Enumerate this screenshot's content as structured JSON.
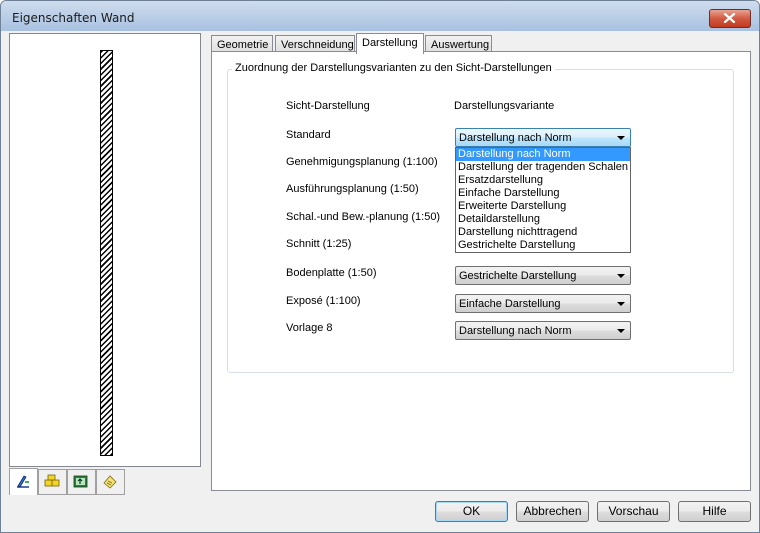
{
  "window": {
    "title": "Eigenschaften Wand"
  },
  "tabs": [
    {
      "label": "Geometrie"
    },
    {
      "label": "Verschneidung"
    },
    {
      "label": "Darstellung"
    },
    {
      "label": "Auswertung"
    }
  ],
  "active_tab": "Darstellung",
  "group": {
    "title": "Zuordnung der Darstellungsvarianten zu den Sicht-Darstellungen",
    "header_left": "Sicht-Darstellung",
    "header_right": "Darstellungsvariante"
  },
  "rows": [
    {
      "label": "Standard",
      "value": "Darstellung nach Norm"
    },
    {
      "label": "Genehmigungsplanung (1:100)",
      "value": ""
    },
    {
      "label": "Ausführungsplanung (1:50)",
      "value": ""
    },
    {
      "label": "Schal.-und Bew.-planung (1:50)",
      "value": ""
    },
    {
      "label": "Schnitt (1:25)",
      "value": ""
    },
    {
      "label": "Bodenplatte (1:50)",
      "value": "Gestrichelte Darstellung"
    },
    {
      "label": "Exposé (1:100)",
      "value": "Einfache Darstellung"
    },
    {
      "label": "Vorlage 8",
      "value": "Darstellung nach Norm"
    }
  ],
  "dropdown": {
    "options": [
      "Darstellung nach Norm",
      "Darstellung der tragenden Schalen",
      "Ersatzdarstellung",
      "Einfache Darstellung",
      "Erweiterte Darstellung",
      "Detaildarstellung",
      "Darstellung nichttragend",
      "Gestrichelte Darstellung"
    ],
    "selected": "Darstellung nach Norm"
  },
  "buttons": {
    "ok": "OK",
    "cancel": "Abbrechen",
    "preview": "Vorschau",
    "help": "Hilfe"
  },
  "icon_tabs": [
    "drawing-properties-icon",
    "layers-icon",
    "attributes-icon",
    "notes-icon"
  ],
  "colors": {
    "selection": "#3399ff",
    "titlebar": "#b9cde6",
    "close": "#d35a42"
  }
}
